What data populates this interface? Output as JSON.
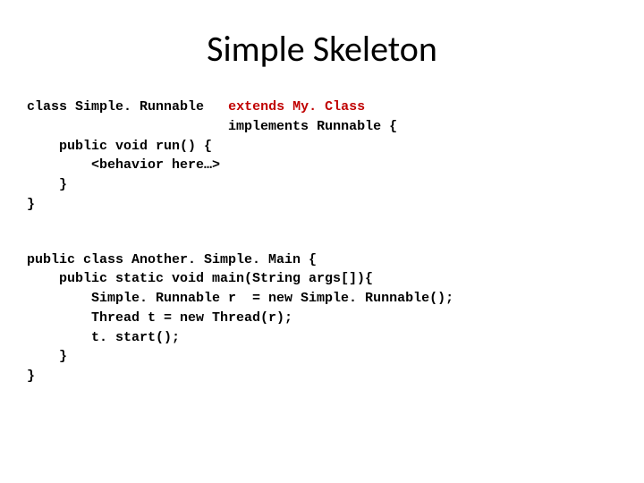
{
  "title": "Simple Skeleton",
  "block1": {
    "l1a": "class Simple. Runnable",
    "l1b": "extends My. Class",
    "l2": "implements Runnable {",
    "l3": "    public void run() {",
    "l4": "        <behavior here…>",
    "l5": "    }",
    "l6": "}"
  },
  "block2": {
    "l1": "public class Another. Simple. Main {",
    "l2": "    public static void main(String args[]){",
    "l3": "        Simple. Runnable r  = new Simple. Runnable();",
    "l4": "        Thread t = new Thread(r);",
    "l5": "        t. start();",
    "l6": "    }",
    "l7": "}"
  }
}
